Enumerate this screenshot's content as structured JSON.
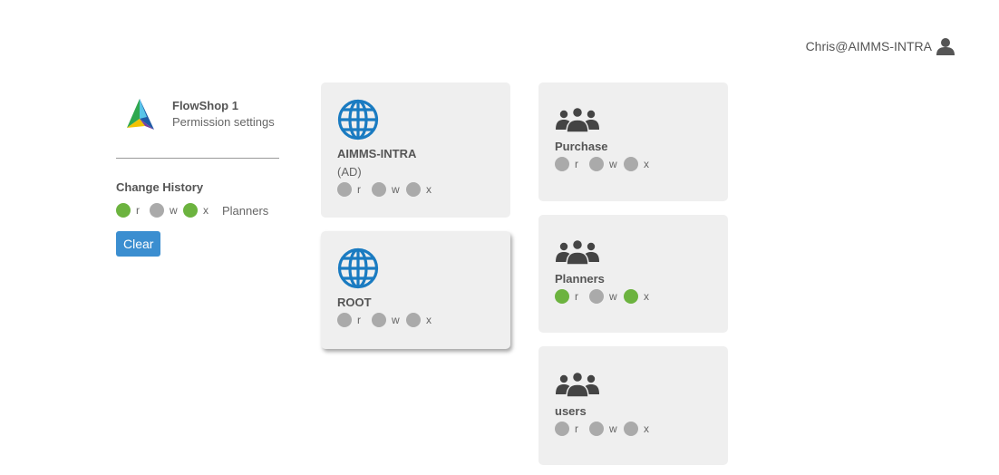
{
  "header": {
    "user_label": "Chris@AIMMS-INTRA",
    "user_icon": "user-icon"
  },
  "sidebar": {
    "app_name": "FlowShop 1",
    "app_subtitle": "Permission settings",
    "history_title": "Change History",
    "history": {
      "perms": [
        {
          "letter": "r",
          "on": true
        },
        {
          "letter": "w",
          "on": false
        },
        {
          "letter": "x",
          "on": true
        }
      ],
      "group": "Planners"
    },
    "clear_label": "Clear"
  },
  "cards": {
    "aimms_intra": {
      "icon": "globe-icon",
      "name": "AIMMS-INTRA",
      "sub": "(AD)",
      "perms": [
        {
          "letter": "r",
          "on": false
        },
        {
          "letter": "w",
          "on": false
        },
        {
          "letter": "x",
          "on": false
        }
      ]
    },
    "root": {
      "icon": "globe-icon",
      "name": "ROOT",
      "perms": [
        {
          "letter": "r",
          "on": false
        },
        {
          "letter": "w",
          "on": false
        },
        {
          "letter": "x",
          "on": false
        }
      ]
    },
    "purchase": {
      "icon": "users-group-icon",
      "name": "Purchase",
      "perms": [
        {
          "letter": "r",
          "on": false
        },
        {
          "letter": "w",
          "on": false
        },
        {
          "letter": "x",
          "on": false
        }
      ]
    },
    "planners": {
      "icon": "users-group-icon",
      "name": "Planners",
      "perms": [
        {
          "letter": "r",
          "on": true
        },
        {
          "letter": "w",
          "on": false
        },
        {
          "letter": "x",
          "on": true
        }
      ]
    },
    "users": {
      "icon": "users-group-icon",
      "name": "users",
      "perms": [
        {
          "letter": "r",
          "on": false
        },
        {
          "letter": "w",
          "on": false
        },
        {
          "letter": "x",
          "on": false
        }
      ]
    }
  },
  "colors": {
    "permission_on": "#6cb33f",
    "permission_off": "#aaaaaa",
    "button": "#3b8ed0",
    "globe": "#1a7bc1"
  }
}
